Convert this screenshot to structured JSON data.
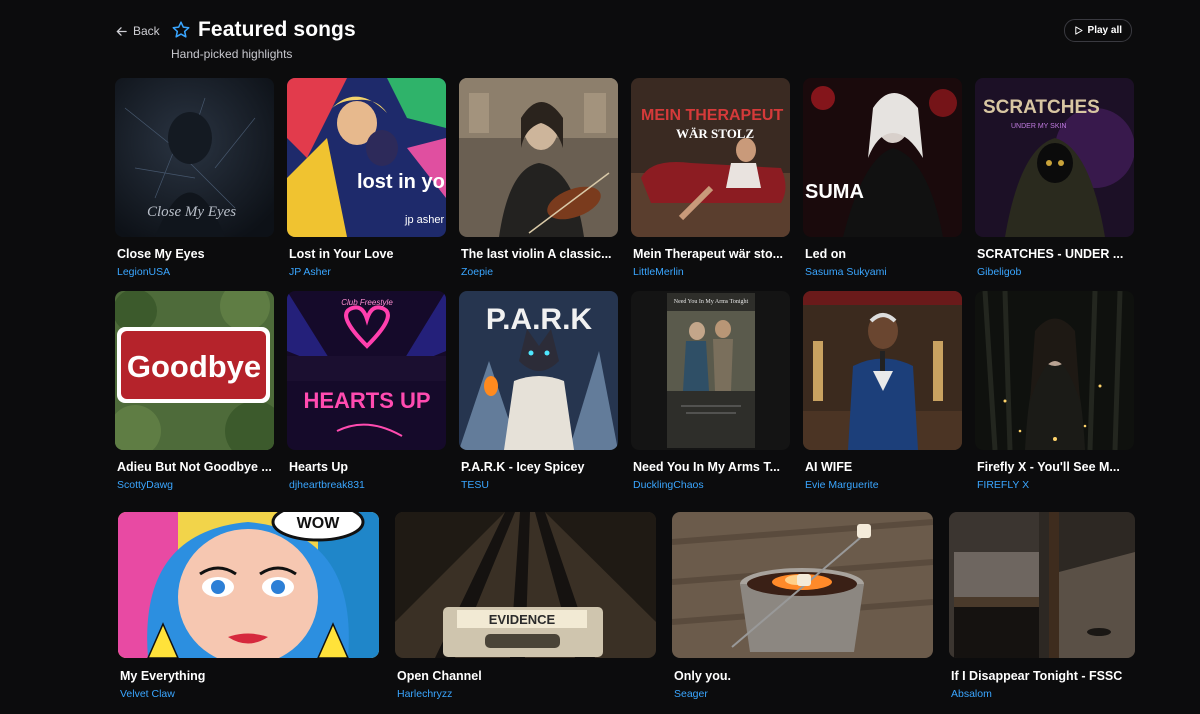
{
  "header": {
    "back_label": "Back",
    "title": "Featured songs",
    "subtitle": "Hand-picked highlights",
    "play_all_label": "Play all"
  },
  "cards": [
    {
      "title": "Close My Eyes",
      "artist": "LegionUSA",
      "art_text": "Close My Eyes"
    },
    {
      "title": "Lost in Your Love",
      "artist": "JP Asher",
      "art_text": "lost in your love",
      "art_subtext": "jp asher"
    },
    {
      "title": "The last violin A classic...",
      "artist": "Zoepie"
    },
    {
      "title": "Mein Therapeut wär sto...",
      "artist": "LittleMerlin",
      "art_text": "MEIN THERAPEUT",
      "art_subtext": "WÄR STOLZ"
    },
    {
      "title": "Led on",
      "artist": "Sasuma Sukyami",
      "art_text": "SUMA"
    },
    {
      "title": "SCRATCHES - UNDER ...",
      "artist": "Gibeligob",
      "art_text": "SCRATCHES",
      "art_subtext": "UNDER MY SKIN"
    },
    {
      "title": "Adieu But Not Goodbye ...",
      "artist": "ScottyDawg",
      "art_text": "Goodbye"
    },
    {
      "title": "Hearts Up",
      "artist": "djheartbreak831",
      "art_text": "HEARTS UP",
      "art_subtext": "Club Freestyle"
    },
    {
      "title": "P.A.R.K - Icey Spicey",
      "artist": "TESU",
      "art_text": "P.A.R.K"
    },
    {
      "title": "Need You In My Arms T...",
      "artist": "DucklingChaos",
      "art_text": "Need You In My Arms Tonight"
    },
    {
      "title": "AI WIFE",
      "artist": "Evie Marguerite"
    },
    {
      "title": "Firefly X - You'll See M...",
      "artist": "FIREFLY X"
    },
    {
      "title": "My Everything",
      "artist": "Velvet Claw",
      "art_text": "WOW"
    },
    {
      "title": "Open Channel",
      "artist": "Harlechryzz",
      "art_text": "EVIDENCE"
    },
    {
      "title": "Only you.",
      "artist": "Seager"
    },
    {
      "title": "If I Disappear Tonight - FSSC",
      "artist": "Absalom"
    }
  ],
  "colors": {
    "background": "#0c0c0d",
    "artist_link": "#3aa6ff",
    "title_text": "#ffffff"
  },
  "icons": {
    "back": "arrow-left-icon",
    "title": "star-outline-icon",
    "play_all": "play-icon"
  }
}
